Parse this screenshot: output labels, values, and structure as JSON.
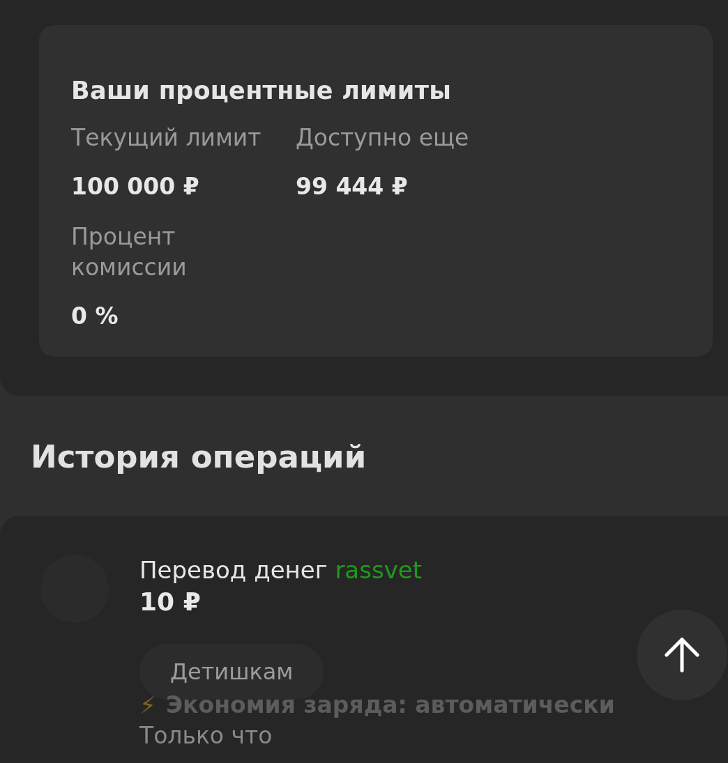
{
  "limits_card": {
    "title": "Ваши процентные лимиты",
    "stats": [
      {
        "label": "Текущий лимит",
        "value": "100 000 ₽"
      },
      {
        "label": "Доступно еще",
        "value": "99 444 ₽"
      },
      {
        "label": "Процент комиссии",
        "value": "0 %"
      }
    ]
  },
  "history": {
    "title": "История операций",
    "operations": [
      {
        "title": "Перевод денег",
        "recipient": "rassvet",
        "amount": "10 ₽",
        "tag": "Детишкам",
        "time": "Только что"
      }
    ]
  },
  "battery_notice": {
    "icon": "⚡",
    "text": "Экономия заряда: автоматически"
  }
}
